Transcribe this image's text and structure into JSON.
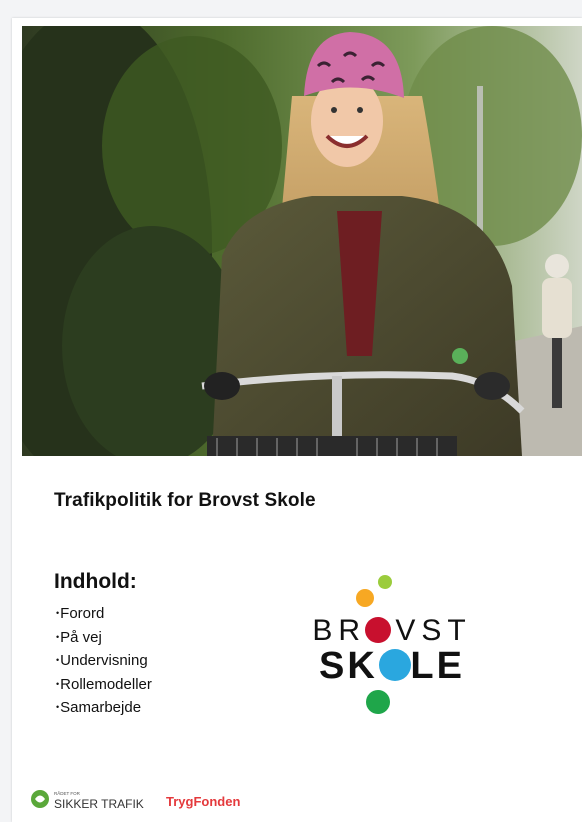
{
  "document": {
    "title": "Trafikpolitik for Brovst Skole",
    "toc_heading": "Indhold:",
    "toc_items": [
      {
        "label": "Forord"
      },
      {
        "label": "På vej"
      },
      {
        "label": "Undervisning"
      },
      {
        "label": "Rollemodeller"
      },
      {
        "label": "Samarbejde"
      }
    ]
  },
  "school_logo": {
    "line1": "BROVST",
    "line2": "SKOLE",
    "colors": {
      "red": "#c8102e",
      "blue": "#2aa7df",
      "green": "#1fa64a",
      "orange": "#f7a823",
      "lime": "#9bcc3c"
    }
  },
  "footer": {
    "sikker_small": "RÅDET FOR",
    "sikker_big": "SIKKER TRAFIK",
    "trygfonden": "TrygFonden"
  },
  "photo": {
    "icon": "photo-girl-bicycle"
  }
}
